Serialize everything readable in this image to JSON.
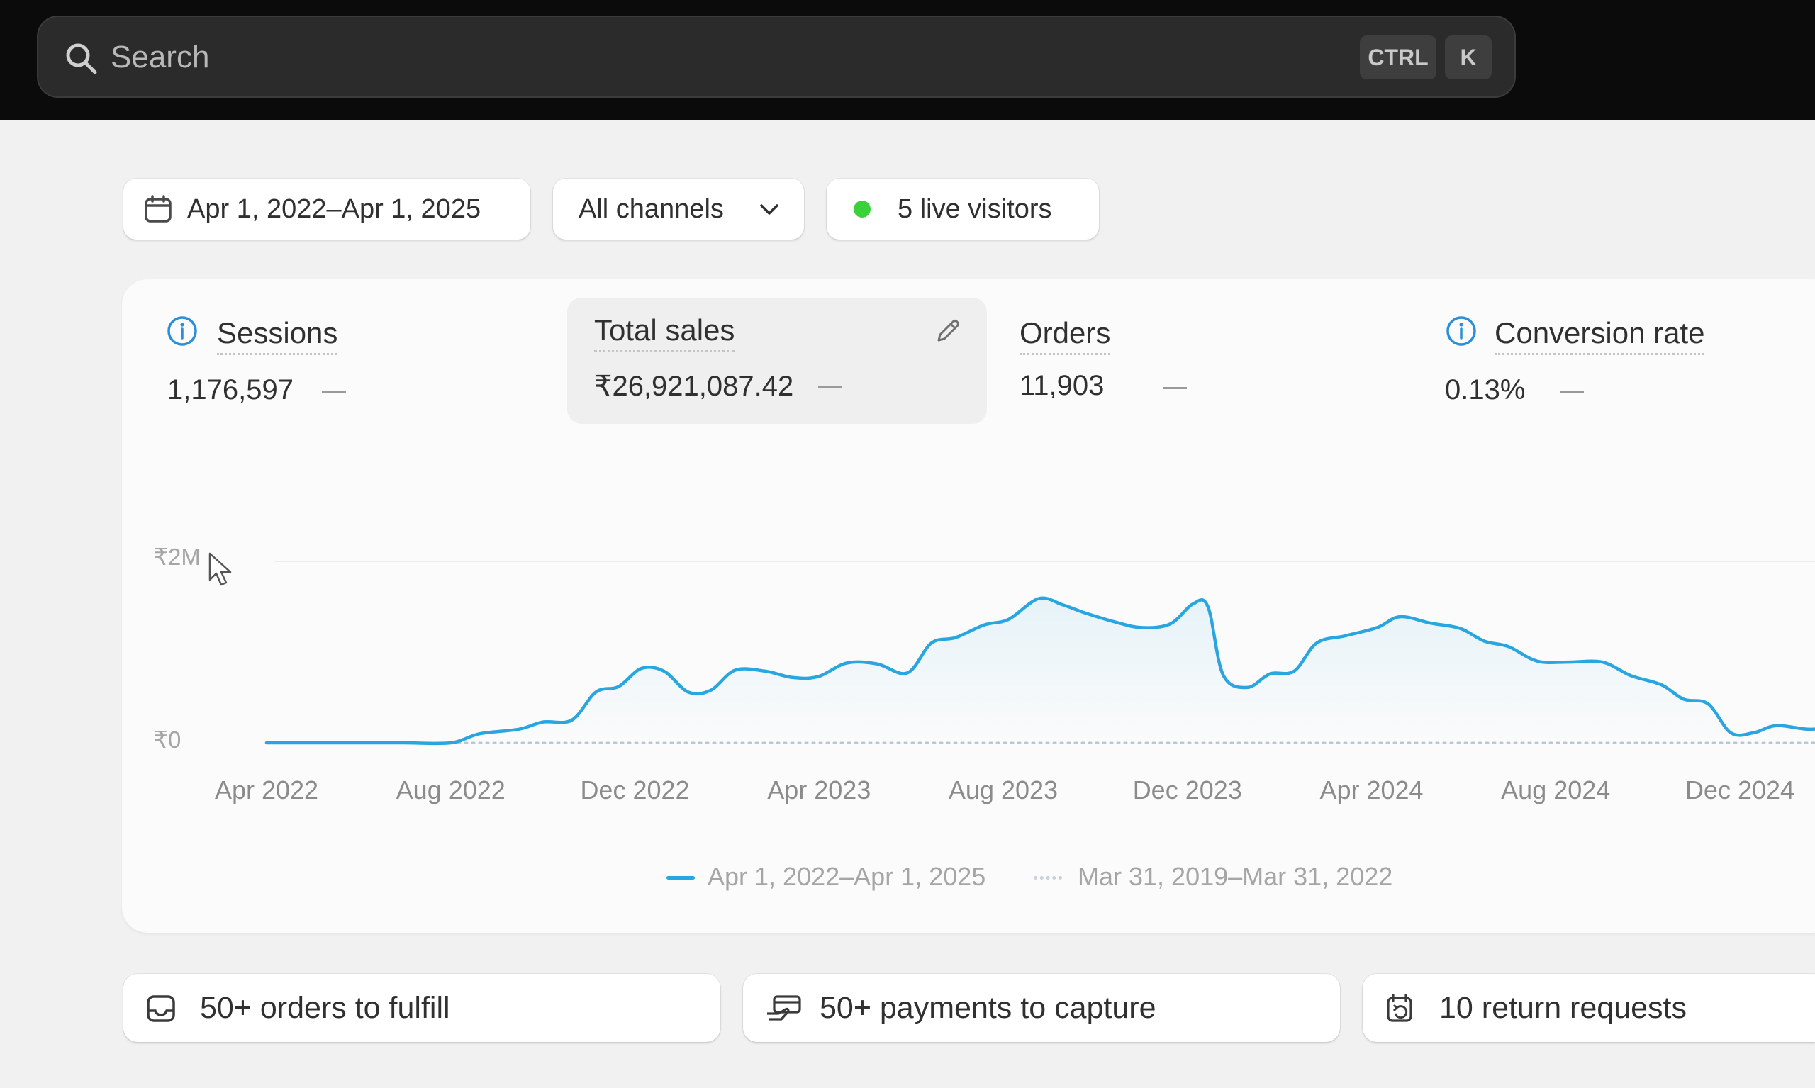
{
  "search": {
    "placeholder": "Search",
    "shortcut_keys": [
      "CTRL",
      "K"
    ]
  },
  "filters": {
    "date_range": "Apr 1, 2022–Apr 1, 2025",
    "channel": "All channels",
    "live_visitors": "5 live visitors",
    "live_dot_color": "#3ad13a"
  },
  "metrics": [
    {
      "label": "Sessions",
      "value": "1,176,597",
      "has_info_icon": true
    },
    {
      "label": "Total sales",
      "value": "₹26,921,087.42",
      "selected": true,
      "has_edit_icon": true
    },
    {
      "label": "Orders",
      "value": "11,903"
    },
    {
      "label": "Conversion rate",
      "value": "0.13%",
      "has_info_icon": true
    }
  ],
  "chart_data": {
    "type": "line",
    "title": "",
    "xlabel": "",
    "ylabel": "",
    "y_tick_labels": [
      "₹0",
      "₹2M"
    ],
    "x_tick_labels": [
      "Apr 2022",
      "Aug 2022",
      "Dec 2022",
      "Apr 2023",
      "Aug 2023",
      "Dec 2023",
      "Apr 2024",
      "Aug 2024",
      "Dec 2024"
    ],
    "ylim": [
      0,
      2000000
    ],
    "grid": true,
    "legend_position": "bottom-center",
    "series": [
      {
        "name": "Apr 1, 2022–Apr 1, 2025",
        "color": "#29a6e0",
        "style": "solid",
        "points": [
          [
            "2022-04-01",
            0
          ],
          [
            "2022-05-01",
            0
          ],
          [
            "2022-06-01",
            0
          ],
          [
            "2022-07-01",
            0
          ],
          [
            "2022-08-01",
            0
          ],
          [
            "2022-08-20",
            100000
          ],
          [
            "2022-09-15",
            150000
          ],
          [
            "2022-10-01",
            230000
          ],
          [
            "2022-10-20",
            250000
          ],
          [
            "2022-11-05",
            560000
          ],
          [
            "2022-11-20",
            620000
          ],
          [
            "2022-12-05",
            820000
          ],
          [
            "2022-12-20",
            790000
          ],
          [
            "2023-01-05",
            560000
          ],
          [
            "2023-01-20",
            580000
          ],
          [
            "2023-02-05",
            800000
          ],
          [
            "2023-02-25",
            790000
          ],
          [
            "2023-03-15",
            720000
          ],
          [
            "2023-04-01",
            730000
          ],
          [
            "2023-04-20",
            880000
          ],
          [
            "2023-05-10",
            870000
          ],
          [
            "2023-05-30",
            770000
          ],
          [
            "2023-06-15",
            1100000
          ],
          [
            "2023-07-01",
            1160000
          ],
          [
            "2023-07-20",
            1300000
          ],
          [
            "2023-08-05",
            1360000
          ],
          [
            "2023-08-25",
            1590000
          ],
          [
            "2023-09-10",
            1520000
          ],
          [
            "2023-09-25",
            1430000
          ],
          [
            "2023-10-15",
            1330000
          ],
          [
            "2023-11-01",
            1270000
          ],
          [
            "2023-11-20",
            1310000
          ],
          [
            "2023-12-05",
            1530000
          ],
          [
            "2023-12-15",
            1500000
          ],
          [
            "2023-12-25",
            750000
          ],
          [
            "2024-01-10",
            610000
          ],
          [
            "2024-01-25",
            760000
          ],
          [
            "2024-02-10",
            790000
          ],
          [
            "2024-02-25",
            1100000
          ],
          [
            "2024-03-15",
            1180000
          ],
          [
            "2024-04-05",
            1270000
          ],
          [
            "2024-04-20",
            1390000
          ],
          [
            "2024-05-10",
            1320000
          ],
          [
            "2024-05-30",
            1260000
          ],
          [
            "2024-06-15",
            1120000
          ],
          [
            "2024-07-01",
            1060000
          ],
          [
            "2024-07-20",
            900000
          ],
          [
            "2024-08-10",
            890000
          ],
          [
            "2024-09-01",
            890000
          ],
          [
            "2024-09-20",
            740000
          ],
          [
            "2024-10-10",
            640000
          ],
          [
            "2024-10-25",
            480000
          ],
          [
            "2024-11-10",
            430000
          ],
          [
            "2024-11-25",
            110000
          ],
          [
            "2024-12-10",
            110000
          ],
          [
            "2024-12-25",
            190000
          ],
          [
            "2025-01-15",
            150000
          ],
          [
            "2025-02-01",
            170000
          ]
        ]
      },
      {
        "name": "Mar 31, 2019–Mar 31, 2022",
        "color": "#b9c8d6",
        "style": "dotted",
        "points": [
          [
            "2022-04-01",
            0
          ],
          [
            "2025-02-01",
            0
          ]
        ]
      }
    ]
  },
  "tasks": [
    {
      "label": "50+ orders to fulfill",
      "icon": "inbox-icon"
    },
    {
      "label": "50+ payments to capture",
      "icon": "payment-icon"
    },
    {
      "label": "10 return requests",
      "icon": "return-icon"
    }
  ]
}
